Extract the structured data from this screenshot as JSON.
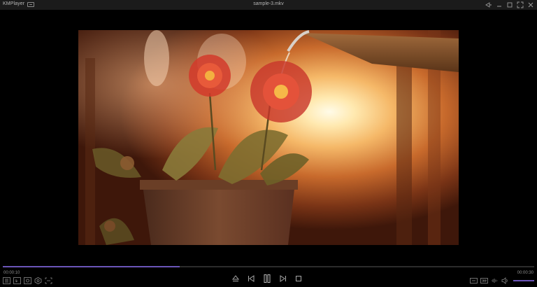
{
  "titlebar": {
    "app_name": "KMPlayer",
    "file_title": "sample-3.mkv",
    "controls": [
      "pin-icon",
      "minimize-icon",
      "maximize-icon",
      "fullscreen-icon",
      "close-icon"
    ]
  },
  "playback": {
    "current_time": "00:00:10",
    "total_time": "00:00:30",
    "progress_fraction": 0.333,
    "volume_fraction": 1.0
  },
  "toolbar": {
    "left": [
      "playlist-icon",
      "subtitle-icon",
      "capture-icon",
      "settings-icon",
      "crop-icon"
    ],
    "center": [
      "eject-icon",
      "previous-icon",
      "pause-icon",
      "next-icon",
      "stop-icon"
    ],
    "right": [
      "screen-mode-icon",
      "3d-icon",
      "audio-wave-icon",
      "volume-icon"
    ]
  },
  "colors": {
    "accent": "#6b55b8",
    "titlebar_bg": "#1b1b1b",
    "background": "#000000"
  }
}
